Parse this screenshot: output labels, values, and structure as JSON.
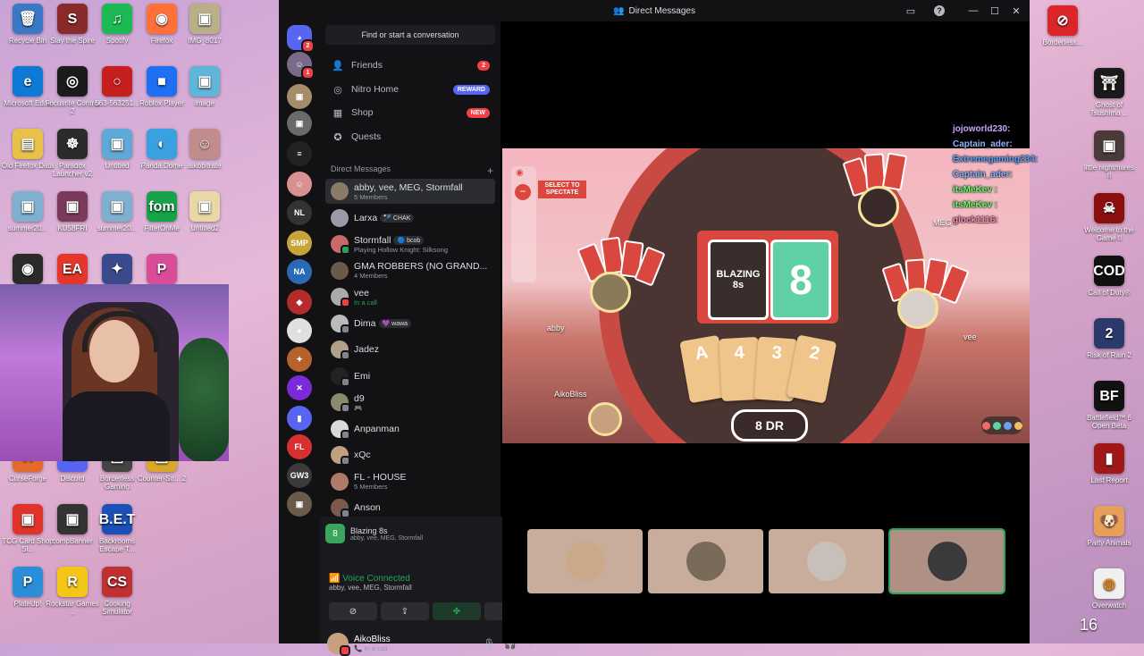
{
  "desktop": {
    "left_icons": [
      {
        "label": "Recycle Bin",
        "glyph": "🗑",
        "color": "#3a78c4"
      },
      {
        "label": "Slay the Spire",
        "glyph": "S",
        "color": "#8a2b2b"
      },
      {
        "label": "Spotify",
        "glyph": "♫",
        "color": "#1db954"
      },
      {
        "label": "Firefox",
        "glyph": "◉",
        "color": "#ff7139"
      },
      {
        "label": "IMG_8017",
        "glyph": "▣",
        "color": "#b9b08a"
      },
      {
        "label": "Microsoft Edge",
        "glyph": "e",
        "color": "#0f7ad6"
      },
      {
        "label": "Focusrite Control 2",
        "glyph": "◎",
        "color": "#1b1b1b"
      },
      {
        "label": "563-563251...",
        "glyph": "○",
        "color": "#c71e1e"
      },
      {
        "label": "Roblox Player",
        "glyph": "■",
        "color": "#1f6ff2"
      },
      {
        "label": "image",
        "glyph": "▣",
        "color": "#5fb6d8"
      },
      {
        "label": "Old Firefox Data",
        "glyph": "▤",
        "color": "#e8c14a"
      },
      {
        "label": "Paradox Launcher v2",
        "glyph": "☸",
        "color": "#2b2b2b"
      },
      {
        "label": "Untitled",
        "glyph": "▣",
        "color": "#5fa8d8"
      },
      {
        "label": "Panda Dome",
        "glyph": "◐",
        "color": "#3aa0e0"
      },
      {
        "label": "aikobitrate",
        "glyph": "☺",
        "color": "#c28c8c"
      },
      {
        "label": "summer20...",
        "glyph": "▣",
        "color": "#7fb0d0"
      },
      {
        "label": "KU58FRI",
        "glyph": "▣",
        "color": "#7b3a5a"
      },
      {
        "label": "summer20...",
        "glyph": "▣",
        "color": "#7fb0d0"
      },
      {
        "label": "FilterOnMe",
        "glyph": "fom",
        "color": "#16a34a"
      },
      {
        "label": "Untitled2",
        "glyph": "▣",
        "color": "#e8d8a8"
      },
      {
        "label": "OBS",
        "glyph": "◉",
        "color": "#2a2a2a"
      },
      {
        "label": "EA",
        "glyph": "EA",
        "color": "#e4362b"
      },
      {
        "label": "",
        "glyph": "✦",
        "color": "#3b4a8c"
      },
      {
        "label": "",
        "glyph": "P",
        "color": "#d94c9a"
      },
      {
        "label": "CurseForge",
        "glyph": "⚒",
        "color": "#e36a2a"
      },
      {
        "label": "Discord",
        "glyph": "◕",
        "color": "#5865f2"
      },
      {
        "label": "Borderless Gaming",
        "glyph": "▤",
        "color": "#444"
      },
      {
        "label": "Counter-Str... 2",
        "glyph": "▣",
        "color": "#d9a82a"
      },
      {
        "label": "TCG Card Shop Si...",
        "glyph": "▣",
        "color": "#e0342b"
      },
      {
        "label": "compBanner",
        "glyph": "▣",
        "color": "#333"
      },
      {
        "label": "Backrooms Escape T...",
        "glyph": "B.E.T",
        "color": "#1d4fb8"
      },
      {
        "label": "PlateUp!",
        "glyph": "P",
        "color": "#2a8fd8"
      },
      {
        "label": "Rockstar Games ...",
        "glyph": "R",
        "color": "#f5c518"
      },
      {
        "label": "Cooking Simulator",
        "glyph": "CS",
        "color": "#c03030"
      }
    ],
    "right_icons": [
      {
        "label": "Borderless...",
        "glyph": "⊘",
        "color": "#d9262b"
      },
      {
        "label": "Ghost of Tsushima ...",
        "glyph": "⛩",
        "color": "#1a1a1a"
      },
      {
        "label": "little nightmares II",
        "glyph": "▣",
        "color": "#4a3a3a"
      },
      {
        "label": "Welcome to the Game II",
        "glyph": "☠",
        "color": "#8a1010"
      },
      {
        "label": "Call of Duty®",
        "glyph": "COD",
        "color": "#111"
      },
      {
        "label": "Risk of Rain 2",
        "glyph": "2",
        "color": "#2b3a6b"
      },
      {
        "label": "Battlefield™ 6 Open Beta",
        "glyph": "BF",
        "color": "#111"
      },
      {
        "label": "Last Report",
        "glyph": "▮",
        "color": "#a01818"
      },
      {
        "label": "Party Animals",
        "glyph": "🐶",
        "color": "#e6a05a"
      },
      {
        "label": "Overwatch",
        "glyph": "◍",
        "color": "#f0f0f0"
      }
    ],
    "clock_fragment": "16"
  },
  "window": {
    "title": "Direct Messages",
    "icons": [
      "inbox-icon",
      "help-icon",
      "minimize-icon",
      "maximize-icon",
      "close-icon"
    ]
  },
  "servers": [
    {
      "glyph": "◕",
      "color": "#5865f2",
      "badge": "2"
    },
    {
      "glyph": "☺",
      "color": "#7a6a8a",
      "badge": "1"
    },
    {
      "glyph": "▣",
      "color": "#a58d6a",
      "badge": ""
    },
    {
      "glyph": "▣",
      "color": "#6a6a6a",
      "badge": ""
    },
    {
      "glyph": "≡",
      "color": "#222",
      "badge": ""
    },
    {
      "glyph": "☺",
      "color": "#d99090",
      "badge": ""
    },
    {
      "glyph": "NL",
      "color": "#333",
      "badge": ""
    },
    {
      "glyph": "SMP",
      "color": "#c8a23a",
      "badge": ""
    },
    {
      "glyph": "NA",
      "color": "#2a6ab5",
      "badge": ""
    },
    {
      "glyph": "◆",
      "color": "#b52a2a",
      "badge": ""
    },
    {
      "glyph": "●",
      "color": "#e0e0e0",
      "badge": ""
    },
    {
      "glyph": "✦",
      "color": "#b5632a",
      "badge": ""
    },
    {
      "glyph": "✕",
      "color": "#7b2ad9",
      "badge": ""
    },
    {
      "glyph": "▮",
      "color": "#5865f2",
      "badge": ""
    },
    {
      "glyph": "FL",
      "color": "#d83030",
      "badge": ""
    },
    {
      "glyph": "GW3",
      "color": "#3a3a3a",
      "badge": ""
    },
    {
      "glyph": "▣",
      "color": "#6a5a4a",
      "badge": ""
    }
  ],
  "dm_panel": {
    "search_placeholder": "Find or start a conversation",
    "nav": [
      {
        "label": "Friends",
        "icon": "friends-icon",
        "glyph": "👤",
        "badge": "2",
        "badge_kind": "red"
      },
      {
        "label": "Nitro Home",
        "icon": "nitro-icon",
        "glyph": "◎",
        "badge": "REWARD",
        "badge_kind": "purple"
      },
      {
        "label": "Shop",
        "icon": "shop-icon",
        "glyph": "▦",
        "badge": "NEW",
        "badge_kind": "red"
      },
      {
        "label": "Quests",
        "icon": "quests-icon",
        "glyph": "✪",
        "badge": "",
        "badge_kind": ""
      }
    ],
    "dm_header": "Direct Messages",
    "add_glyph": "+",
    "dms": [
      {
        "name": "abby, vee, MEG, Stormfall",
        "sub": "5 Members",
        "sub_kind": "muted",
        "tag": "",
        "color": "#8a7a6a",
        "status": "",
        "active": true
      },
      {
        "name": "Larxa",
        "sub": "",
        "sub_kind": "muted",
        "tag": "🏸 CHAK",
        "color": "#9a9aa8",
        "status": "",
        "active": false
      },
      {
        "name": "Stormfall",
        "sub": "Playing Hollow Knight: Silksong",
        "sub_kind": "muted",
        "tag": "🔵 bcob",
        "color": "#c86a6a",
        "status": "#23a55a",
        "active": false
      },
      {
        "name": "GMA ROBBERS (NO GRAND...",
        "sub": "4 Members",
        "sub_kind": "muted",
        "tag": "",
        "color": "#6a5a4a",
        "status": "",
        "active": false
      },
      {
        "name": "vee",
        "sub": "In a call",
        "sub_kind": "green",
        "tag": "",
        "color": "#aaa",
        "status": "#f23f43",
        "active": false
      },
      {
        "name": "Dima",
        "sub": "",
        "sub_kind": "muted",
        "tag": "💜 wawa",
        "color": "#bbb",
        "status": "#80848e",
        "active": false
      },
      {
        "name": "Jadez",
        "sub": "",
        "sub_kind": "muted",
        "tag": "",
        "color": "#b0a08a",
        "status": "#80848e",
        "active": false
      },
      {
        "name": "Emi",
        "sub": "",
        "sub_kind": "muted",
        "tag": "",
        "color": "#222",
        "status": "#80848e",
        "active": false
      },
      {
        "name": "d9",
        "sub": "🎮",
        "sub_kind": "muted",
        "tag": "",
        "color": "#8a8a6a",
        "status": "#80848e",
        "active": false
      },
      {
        "name": "Anpanman",
        "sub": "",
        "sub_kind": "muted",
        "tag": "",
        "color": "#d9d9d9",
        "status": "#80848e",
        "active": false
      },
      {
        "name": "xQc",
        "sub": "",
        "sub_kind": "muted",
        "tag": "",
        "color": "#c0a080",
        "status": "#80848e",
        "active": false
      },
      {
        "name": "FL - HOUSE",
        "sub": "5 Members",
        "sub_kind": "muted",
        "tag": "",
        "color": "#b07a6a",
        "status": "",
        "active": false
      },
      {
        "name": "Anson",
        "sub": "",
        "sub_kind": "muted",
        "tag": "",
        "color": "#7a5a4a",
        "status": "#80848e",
        "active": false
      }
    ]
  },
  "activity_card": {
    "title": "Blazing 8s",
    "sub": "abby, vee, MEG, Stormfall",
    "icon": "blazing-8s-icon"
  },
  "voice": {
    "status": "Voice Connected",
    "channel": "abby, vee, MEG, Stormfall",
    "buttons": [
      {
        "name": "camera-off-button",
        "glyph": "⊘"
      },
      {
        "name": "screenshare-button",
        "glyph": "⇪"
      },
      {
        "name": "activity-button",
        "glyph": "✤"
      },
      {
        "name": "soundboard-button",
        "glyph": "✺"
      }
    ]
  },
  "me": {
    "name": "AikoBliss",
    "status": "In a call"
  },
  "game": {
    "deck_text": "BLAZING 8s",
    "pile_value": "8",
    "hand": [
      "A",
      "4",
      "3",
      "2"
    ],
    "announcement": "8 DR",
    "spectate_label": "SELECT TO SPECTATE",
    "players": [
      {
        "name": "MEG",
        "pos": "top-right"
      },
      {
        "name": "abby",
        "pos": "left"
      },
      {
        "name": "vee",
        "pos": "right"
      },
      {
        "name": "AikoBliss",
        "pos": "bottom-left"
      }
    ]
  },
  "tiles": [
    {
      "name": "participant-tile-1",
      "color": "#c9a98a",
      "speaking": false
    },
    {
      "name": "participant-tile-2",
      "color": "#7a6a5a",
      "speaking": false
    },
    {
      "name": "participant-tile-3",
      "color": "#c8c0b8",
      "speaking": false
    },
    {
      "name": "participant-tile-4",
      "color": "#3a3a3a",
      "speaking": true
    }
  ],
  "chat": [
    {
      "user": "jojoworld230:",
      "color": "#c7a6ff"
    },
    {
      "user": "Captain_ader:",
      "color": "#8ab4ff"
    },
    {
      "user": "Extremegaming234:",
      "color": "#5aa0ff"
    },
    {
      "user": "Captain_ader:",
      "color": "#8ab4ff"
    },
    {
      "user": "itsMeKev :",
      "color": "#6aff6a"
    },
    {
      "user": "itsMeKev :",
      "color": "#6aff6a"
    },
    {
      "user": "glock1116:",
      "color": "#ff8ab4"
    }
  ]
}
